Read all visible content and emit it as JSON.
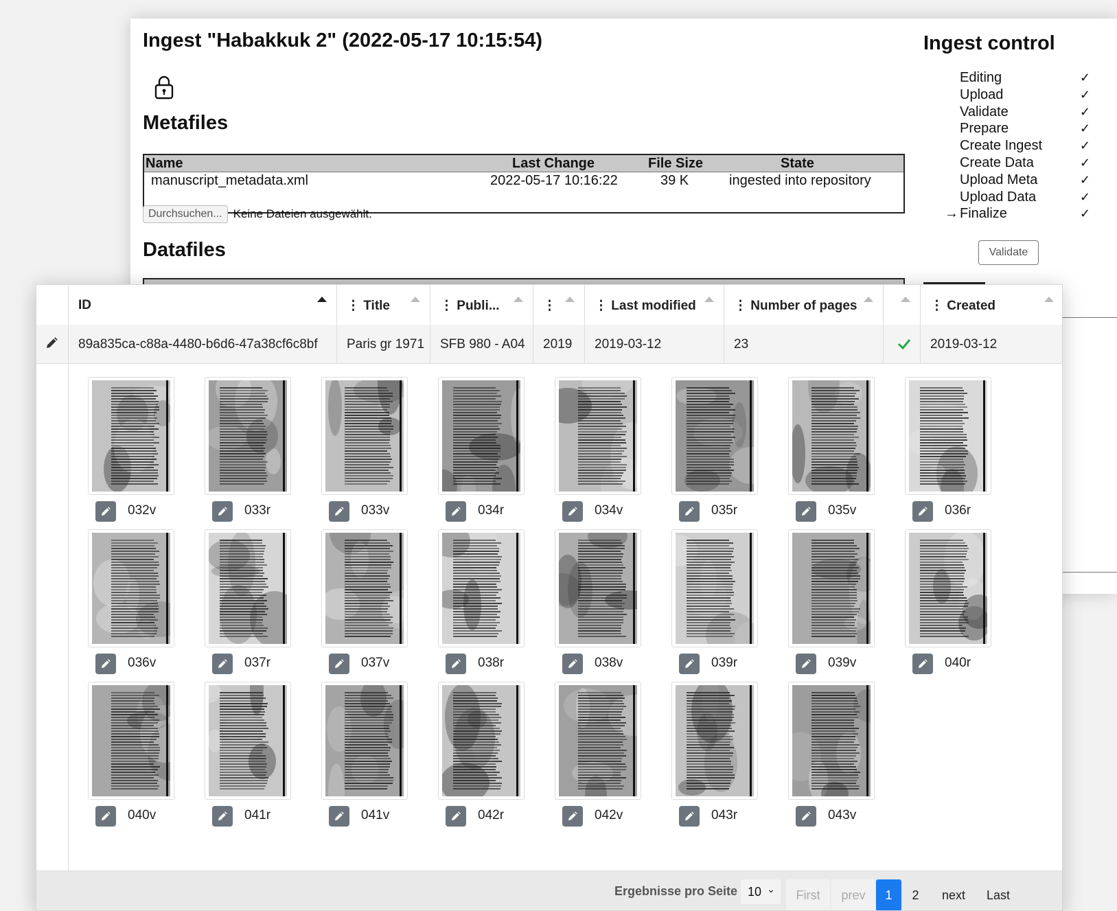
{
  "ingest": {
    "title": "Ingest \"Habakkuk 2\" (2022-05-17 10:15:54)",
    "metafiles_heading": "Metafiles",
    "datafiles_heading": "Datafiles",
    "meta_table": {
      "headers": [
        "Name",
        "Last Change",
        "File Size",
        "State"
      ],
      "row": [
        "manuscript_metadata.xml",
        "2022-05-17 10:16:22",
        "39 K",
        "ingested into repository"
      ]
    },
    "browse_button": "Durchsuchen...",
    "no_file_text": "Keine Dateien ausgewählt."
  },
  "control": {
    "title": "Ingest control",
    "current_arrow": "→",
    "check": "✓",
    "steps": [
      {
        "label": "Editing"
      },
      {
        "label": "Upload"
      },
      {
        "label": "Validate"
      },
      {
        "label": "Prepare"
      },
      {
        "label": "Create Ingest"
      },
      {
        "label": "Create Data"
      },
      {
        "label": "Upload Meta"
      },
      {
        "label": "Upload Data"
      },
      {
        "label": "Finalize"
      }
    ],
    "current_step": "Finalize",
    "validate_button": "Validate"
  },
  "grid": {
    "column_menu_glyph": "⋮",
    "columns": [
      "ID",
      "Title",
      "Publi...",
      "",
      "Last modified",
      "Number of pages",
      "",
      "Created"
    ],
    "row": {
      "id": "89a835ca-c88a-4480-b6d6-47a38cf6c8bf",
      "title": "Paris gr 1971",
      "publication": "SFB 980 - A04",
      "year": "2019",
      "last_modified": "2019-03-12",
      "pages": "23",
      "created": "2019-03-12"
    },
    "thumbnails": [
      "032v",
      "033r",
      "033v",
      "034r",
      "034v",
      "035r",
      "035v",
      "036r",
      "036v",
      "037r",
      "037v",
      "038r",
      "038v",
      "039r",
      "039v",
      "040r",
      "040v",
      "041r",
      "041v",
      "042r",
      "042v",
      "043r",
      "043v"
    ],
    "pager": {
      "per_page_label": "Ergebnisse pro Seite",
      "per_page_value": "10",
      "first": "First",
      "prev": "prev",
      "pages": [
        "1",
        "2"
      ],
      "current_page": "1",
      "next": "next",
      "last": "Last"
    }
  }
}
